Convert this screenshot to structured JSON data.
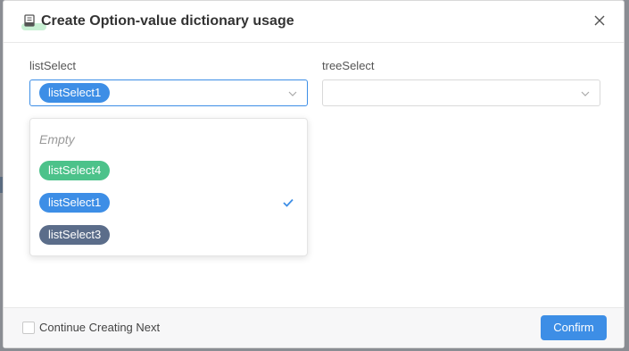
{
  "dialog": {
    "title": "Create Option-value dictionary usage"
  },
  "fields": {
    "list_select": {
      "label": "listSelect",
      "selected_tag": "listSelect1"
    },
    "tree_select": {
      "label": "treeSelect",
      "value": ""
    }
  },
  "dropdown": {
    "empty_text": "Empty",
    "options": [
      {
        "label": "listSelect4",
        "color": "#4cc28a",
        "selected": false
      },
      {
        "label": "listSelect1",
        "color": "#3d8ee6",
        "selected": true
      },
      {
        "label": "listSelect3",
        "color": "#5b6d8a",
        "selected": false
      }
    ]
  },
  "footer": {
    "continue_label": "Continue Creating Next",
    "continue_checked": false,
    "confirm_label": "Confirm"
  },
  "colors": {
    "accent": "#3d8ee6",
    "tag_green": "#4cc28a",
    "tag_slate": "#5b6d8a"
  }
}
